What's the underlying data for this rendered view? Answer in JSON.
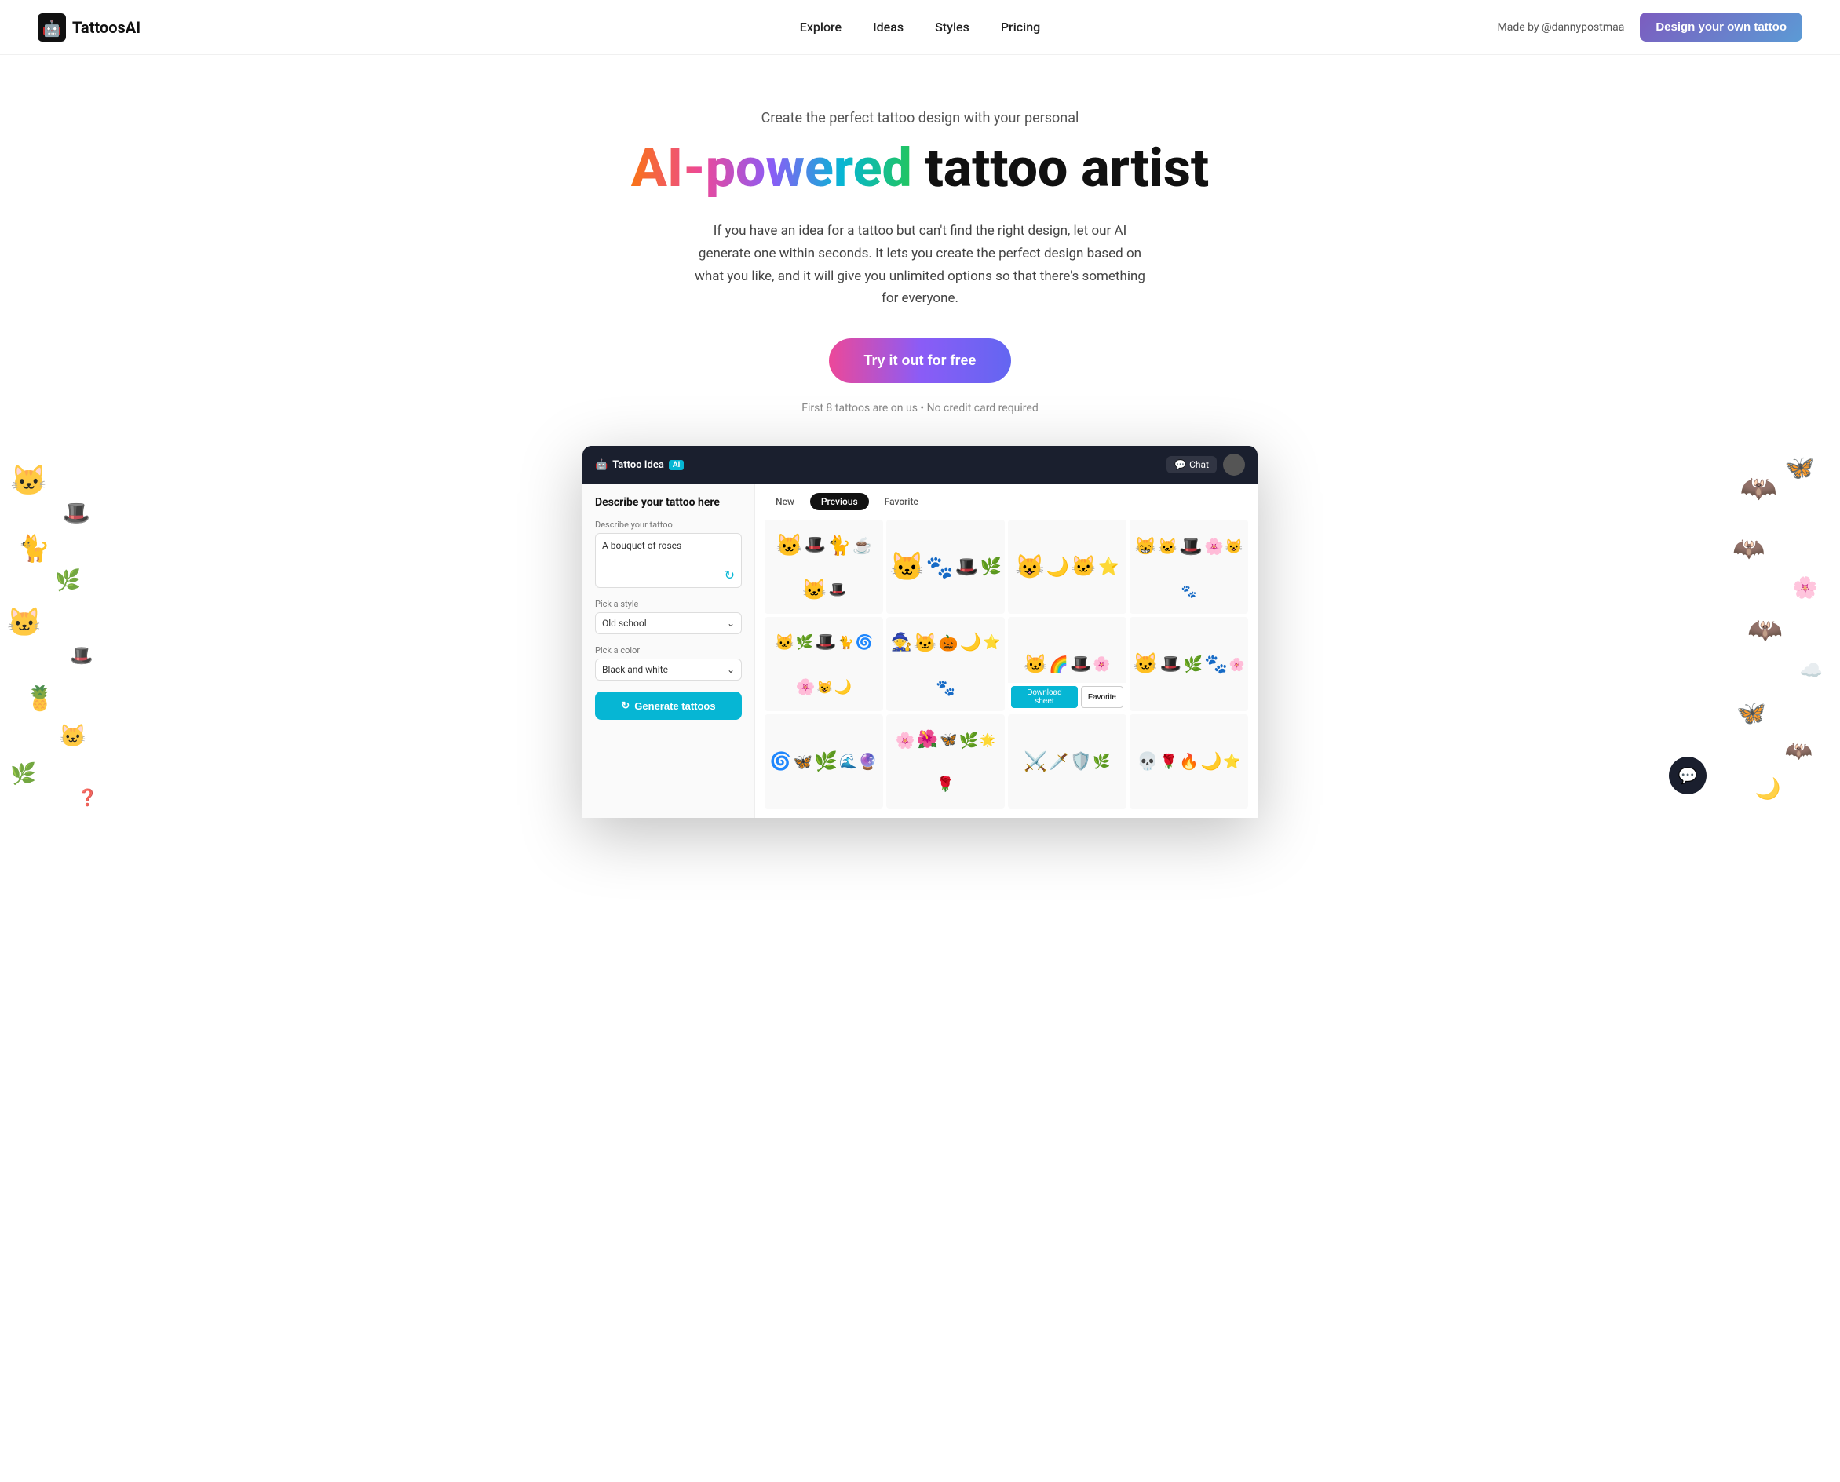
{
  "nav": {
    "brand": "TattoosAI",
    "links": [
      "Explore",
      "Ideas",
      "Styles",
      "Pricing"
    ],
    "made_by": "Made by @dannypostmaa",
    "cta_label": "Design your own tattoo"
  },
  "hero": {
    "subtitle": "Create the perfect tattoo design with your personal",
    "title_gradient": "AI-powered",
    "title_rest": " tattoo artist",
    "description": "If you have an idea for a tattoo but can't find the right design, let our AI generate one within seconds. It lets you create the perfect design based on what you like, and it will give you unlimited options so that there's something for everyone.",
    "cta_label": "Try it out for free",
    "note": "First 8 tattoos are on us • No credit card required"
  },
  "app": {
    "titlebar": {
      "logo": "Tattoo Idea",
      "ai_badge": "AI",
      "chat_label": "Chat"
    },
    "left_panel": {
      "title": "Describe your tattoo here",
      "textarea_label": "Describe your tattoo",
      "textarea_value": "A bouquet of roses",
      "style_label": "Pick a style",
      "style_value": "Old school",
      "color_label": "Pick a color",
      "color_value": "Black and white",
      "generate_label": "Generate tattoos"
    },
    "tabs": [
      "New",
      "Previous",
      "Favorite"
    ],
    "active_tab": "Previous"
  }
}
